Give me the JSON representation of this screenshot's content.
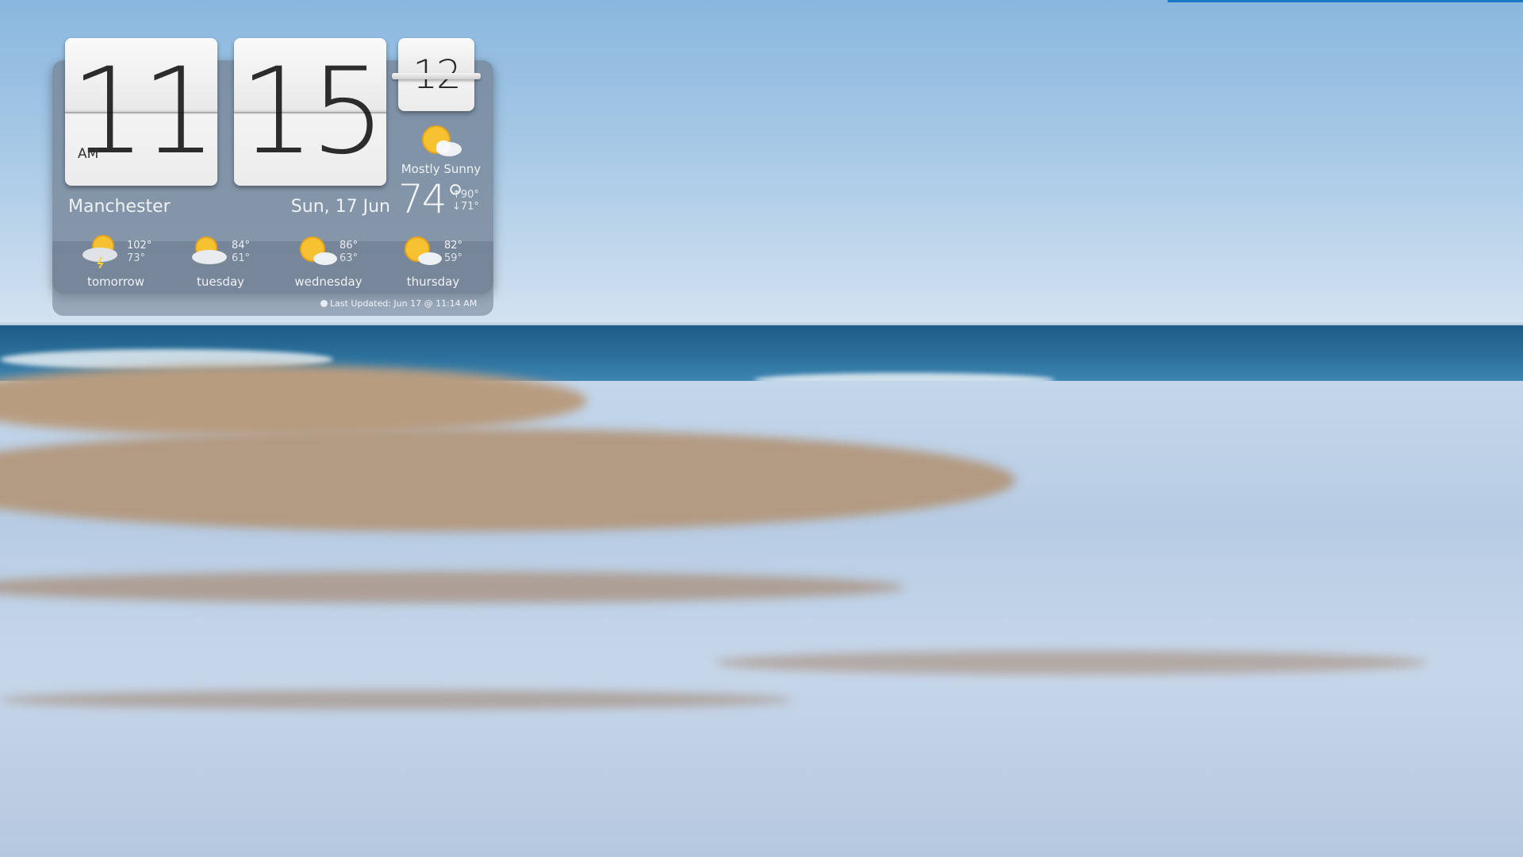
{
  "clock": {
    "hours": "11",
    "minutes": "15",
    "seconds": "12",
    "ampm": "AM"
  },
  "location": {
    "city": "Manchester",
    "date": "Sun, 17 Jun"
  },
  "current": {
    "condition": "Mostly Sunny",
    "temp": "74°",
    "high": "↑90°",
    "low": "↓71°",
    "icon": "partly-sunny-icon"
  },
  "forecast": [
    {
      "day": "tomorrow",
      "high": "102°",
      "low": "73°",
      "icon": "thunderstorm-sun-icon"
    },
    {
      "day": "tuesday",
      "high": "84°",
      "low": "61°",
      "icon": "partly-cloudy-icon"
    },
    {
      "day": "wednesday",
      "high": "86°",
      "low": "63°",
      "icon": "mostly-sunny-icon"
    },
    {
      "day": "thursday",
      "high": "82°",
      "low": "59°",
      "icon": "mostly-sunny-icon"
    }
  ],
  "status": {
    "last_updated": "Last Updated: Jun 17 @ 11:14 AM"
  },
  "colors": {
    "accent_bar": "#1e78c8",
    "panel": "#768496"
  }
}
